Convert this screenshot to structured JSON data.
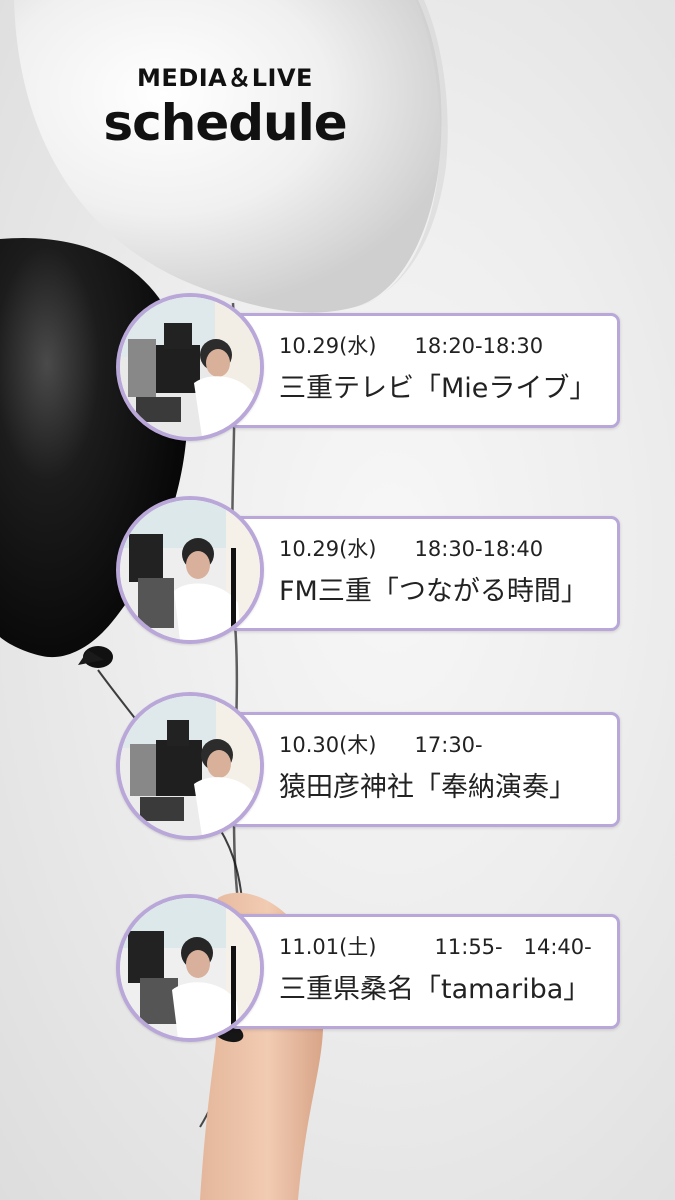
{
  "header": {
    "subtitle": "MEDIA＆LIVE",
    "title": "schedule"
  },
  "schedule": [
    {
      "date": "10.29(水)",
      "time": "18:20-18:30",
      "event": "三重テレビ「Mieライブ」"
    },
    {
      "date": "10.29(水)",
      "time": "18:30-18:40",
      "event": "FM三重「つながる時間」"
    },
    {
      "date": "10.30(木)",
      "time": "17:30-",
      "event": "猿田彦神社「奉納演奏」"
    },
    {
      "date": "11.01(土)",
      "time": "11:55-　14:40-",
      "event": "三重県桑名「tamariba」"
    }
  ],
  "colors": {
    "accent": "#b8a7d8",
    "text": "#222222",
    "card_background": "#ffffff",
    "balloon_black": "#111111",
    "balloon_white": "#f5f5f5"
  },
  "icons": {
    "avatar_photo": "person-with-camera-photo"
  }
}
